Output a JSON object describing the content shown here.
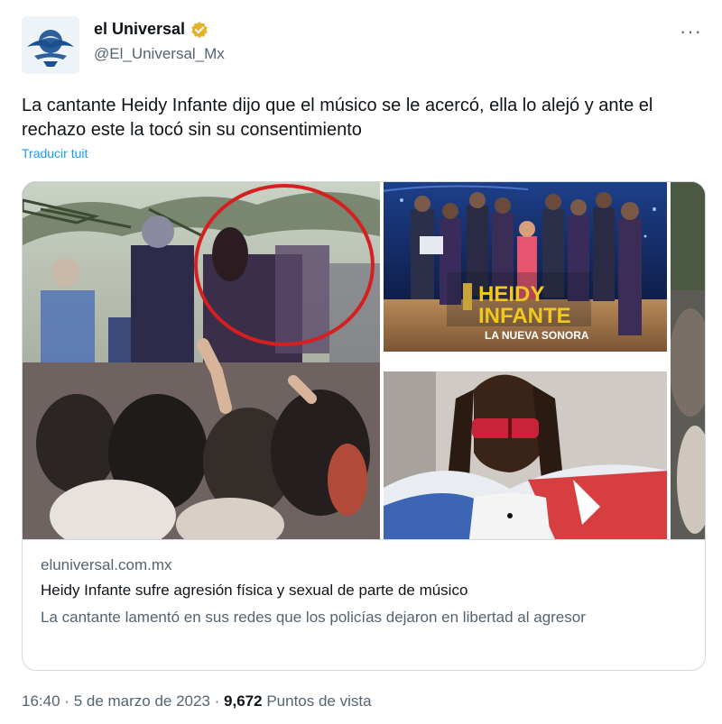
{
  "account": {
    "name": "el Universal",
    "handle": "@El_Universal_Mx",
    "verified_icon": "verified-badge-icon",
    "verified_color": "#e6b12a"
  },
  "menu": {
    "more_label": "···"
  },
  "tweet": {
    "text": "La cantante Heidy Infante dijo que el músico se le acercó, ella lo alejó y ante el rechazo este la tocó sin su consentimiento",
    "translate_label": "Traducir tuit"
  },
  "card": {
    "domain": "eluniversal.com.mx",
    "title": "Heidy Infante sufre agresión física y sexual de parte de músico",
    "description": "La cantante lamentó en sus redes que los policías dejaron en libertad al agresor",
    "poster": {
      "title_line1": "HEIDY",
      "title_line2": "INFANTE",
      "subtitle": "LA NUEVA SONORA"
    }
  },
  "meta": {
    "time": "16:40",
    "separator": "·",
    "date": "5 de marzo de 2023",
    "views_count": "9,672",
    "views_label": "Puntos de vista"
  },
  "colors": {
    "accent": "#1d9bf0",
    "text": "#0f1419",
    "secondary": "#536471",
    "border": "#cfd9de",
    "circle": "#d42020"
  }
}
